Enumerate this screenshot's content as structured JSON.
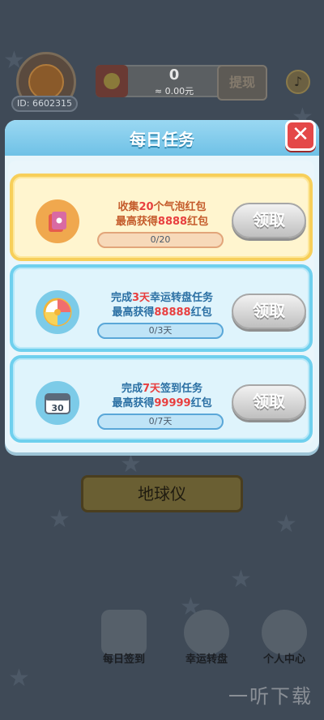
{
  "top_bar": {
    "user_id": "ID: 6602315",
    "balance": "0",
    "balance_cny": "≈ 0.00元",
    "withdraw": "提现"
  },
  "modal": {
    "title": "每日任务",
    "close": "✕"
  },
  "tasks": [
    {
      "line1_prefix": "收集",
      "line1_highlight": "20",
      "line1_suffix": "个气泡红包",
      "line2_prefix": "最高获得",
      "line2_highlight": "8888",
      "line2_suffix": "红包",
      "progress_text": "0/20",
      "progress_fraction": 0,
      "claim": "领取"
    },
    {
      "line1_prefix": "完成",
      "line1_highlight": "3天",
      "line1_suffix": "幸运转盘任务",
      "line2_prefix": "最高获得",
      "line2_highlight": "88888",
      "line2_suffix": "红包",
      "progress_text": "0/3天",
      "progress_fraction": 0,
      "claim": "领取"
    },
    {
      "line1_prefix": "完成",
      "line1_highlight": "7天",
      "line1_suffix": "签到任务",
      "line2_prefix": "最高获得",
      "line2_highlight": "99999",
      "line2_suffix": "红包",
      "progress_text": "0/7天",
      "progress_fraction": 0,
      "claim": "领取"
    }
  ],
  "background": {
    "globe_button": "地球仪",
    "nav": [
      "每日签到",
      "幸运转盘",
      "个人中心"
    ],
    "watermark": "一听下载"
  },
  "colors": {
    "accent_red": "#e83f3f",
    "header_blue": "#6fc1e6",
    "gold_border": "#f7cf5a",
    "blue_border": "#6fd0ee"
  }
}
